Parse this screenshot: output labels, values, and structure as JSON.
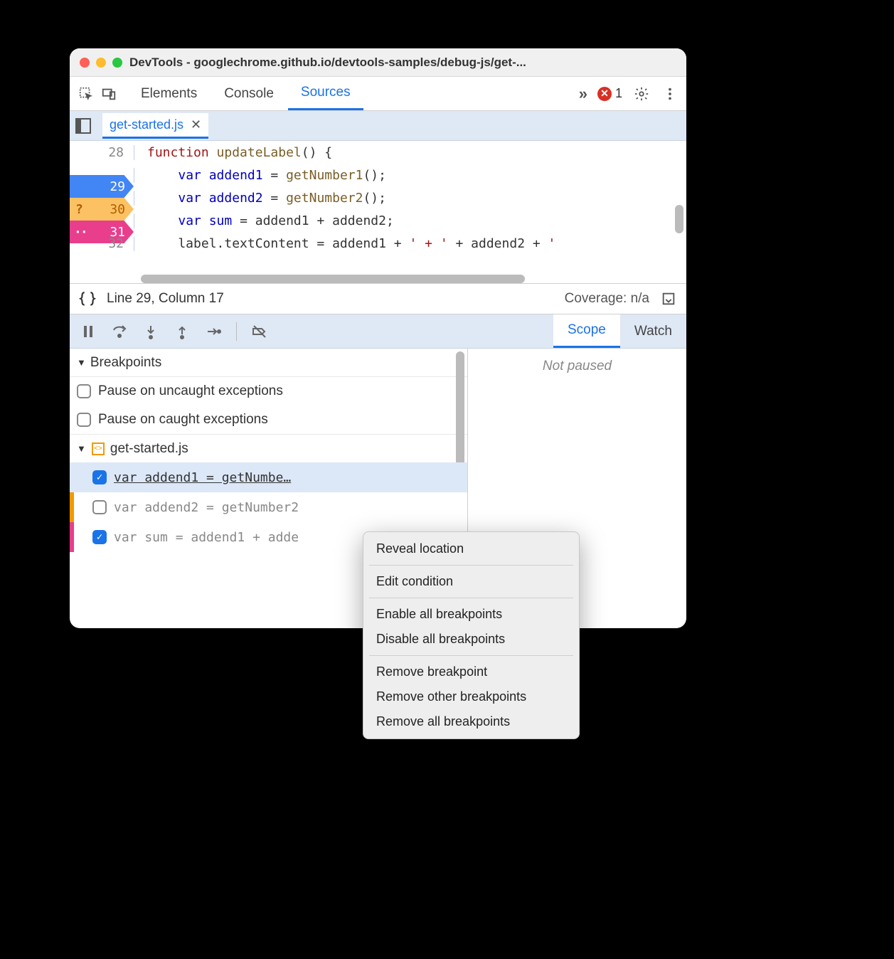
{
  "window": {
    "title": "DevTools - googlechrome.github.io/devtools-samples/debug-js/get-..."
  },
  "toolbar": {
    "tabs": [
      "Elements",
      "Console",
      "Sources"
    ],
    "active_tab": "Sources",
    "error_count": "1"
  },
  "file_tab": {
    "name": "get-started.js"
  },
  "code": {
    "lines": [
      {
        "num": "28",
        "indent": "",
        "text": "function updateLabel() {"
      },
      {
        "num": "29",
        "bp": "blue",
        "text": "    var addend1 = getNumber1();"
      },
      {
        "num": "30",
        "bp": "orange",
        "text": "    var addend2 = getNumber2();"
      },
      {
        "num": "31",
        "bp": "pink",
        "text": "    var sum = addend1 + addend2;"
      },
      {
        "num": "32",
        "text": "    label.textContent = addend1 + ' + ' + addend2 + '"
      }
    ]
  },
  "status": {
    "pos": "Line 29, Column 17",
    "coverage": "Coverage: n/a"
  },
  "right_tabs": {
    "scope": "Scope",
    "watch": "Watch"
  },
  "not_paused": "Not paused",
  "breakpoints": {
    "header": "Breakpoints",
    "uncaught": "Pause on uncaught exceptions",
    "caught": "Pause on caught exceptions",
    "file": "get-started.js",
    "items": [
      {
        "checked": true,
        "text": "var addend1 = getNumbe…",
        "selected": true
      },
      {
        "checked": false,
        "text": "var addend2 = getNumber2",
        "strip": "orange"
      },
      {
        "checked": true,
        "text": "var sum = addend1 + adde",
        "strip": "pink"
      }
    ]
  },
  "context_menu": {
    "reveal": "Reveal location",
    "edit": "Edit condition",
    "enable_all": "Enable all breakpoints",
    "disable_all": "Disable all breakpoints",
    "remove": "Remove breakpoint",
    "remove_other": "Remove other breakpoints",
    "remove_all": "Remove all breakpoints"
  }
}
